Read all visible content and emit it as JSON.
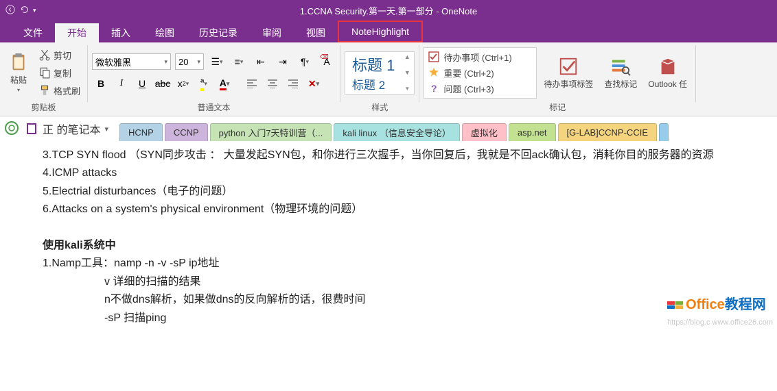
{
  "window": {
    "title": "1.CCNA Security.第一天.第一部分  -  OneNote"
  },
  "ribbonTabs": {
    "file": "文件",
    "home": "开始",
    "insert": "插入",
    "draw": "绘图",
    "history": "历史记录",
    "review": "审阅",
    "view": "视图",
    "noteHighlight": "NoteHighlight"
  },
  "ribbon": {
    "clipboard": {
      "paste": "粘贴",
      "cut": "剪切",
      "copy": "复制",
      "formatPainter": "格式刷",
      "groupLabel": "剪贴板"
    },
    "font": {
      "name": "微软雅黑",
      "size": "20",
      "groupLabel": "普通文本"
    },
    "styles": {
      "heading1": "标题 1",
      "heading2": "标题 2",
      "groupLabel": "样式"
    },
    "tags": {
      "todo": "待办事项 (Ctrl+1)",
      "important": "重要 (Ctrl+2)",
      "question": "问题 (Ctrl+3)",
      "todoBtn": "待办事项标签",
      "findTags": "查找标记",
      "outlook": "Outlook 任",
      "groupLabel": "标记"
    }
  },
  "notebook": {
    "name": "正 的笔记本",
    "sections": {
      "s0": "HCNP",
      "s1": "CCNP",
      "s2": "python 入门7天特训营（...",
      "s3": "kali linux （信息安全导论）",
      "s4": "虚拟化",
      "s5": "asp.net",
      "s6": "[G-LAB]CCNP-CCIE"
    },
    "colors": {
      "c0": "#B3D2E6",
      "c1": "#CDB4DC",
      "c2": "#C5E3B4",
      "c3": "#A8E2E0",
      "c4": "#FFC0C7",
      "c5": "#C2E292",
      "c6": "#F4D47F",
      "c7": "#97CCEB"
    }
  },
  "content": {
    "line1": "3.TCP SYN flood （SYN同步攻击 ： 大量发起SYN包，和你进行三次握手，当你回复后，我就是不回ack确认包，消耗你目的服务器的资源",
    "line2": "4.ICMP attacks",
    "line3": "5.Electrial disturbances（电子的问题）",
    "line4": "6.Attacks on a system's physical environment（物理环境的问题）",
    "boldLine": "使用kali系统中",
    "line5": "1.Namp工具：namp -n -v -sP ip地址",
    "line6": "v 详细的扫描的结果",
    "line7": "n不做dns解析，如果做dns的反向解析的话，很费时间",
    "line8": "-sP 扫描ping"
  },
  "watermark": {
    "brand1": "Office",
    "brand2": "教程网",
    "url": "https://blog.c         www.office26.com"
  }
}
